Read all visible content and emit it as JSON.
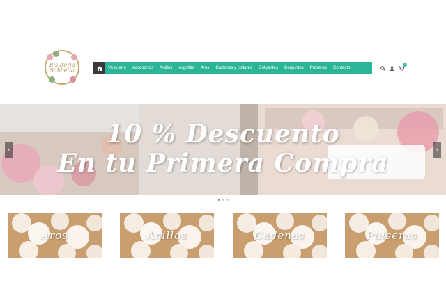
{
  "logo": {
    "text": "Bisuteria Sabbelia",
    "alt": "store-logo"
  },
  "nav": {
    "home_icon": "home-icon",
    "items": [
      {
        "label": "Vestuario"
      },
      {
        "label": "Accesorios"
      },
      {
        "label": "Anillos"
      },
      {
        "label": "Argollas"
      },
      {
        "label": "Aros"
      },
      {
        "label": "Cadenas y collares"
      },
      {
        "label": "Colgantes"
      },
      {
        "label": "Conjuntos"
      },
      {
        "label": "Pulseras"
      },
      {
        "label": "Contacto"
      }
    ],
    "accent_color": "#2bb597"
  },
  "header_icons": {
    "search": "search-icon",
    "account": "user-icon",
    "cart": "cart-icon",
    "cart_count": "0"
  },
  "slider": {
    "line1": "10 % Descuento",
    "line2": "En tu Primera Compra",
    "prev_icon": "chevron-left-icon",
    "next_icon": "chevron-right-icon",
    "dot_count": 3,
    "active_dot": 1
  },
  "categories": [
    {
      "label": "Aros"
    },
    {
      "label": "Anillos"
    },
    {
      "label": "Cadenas"
    },
    {
      "label": "Pulseras"
    }
  ]
}
